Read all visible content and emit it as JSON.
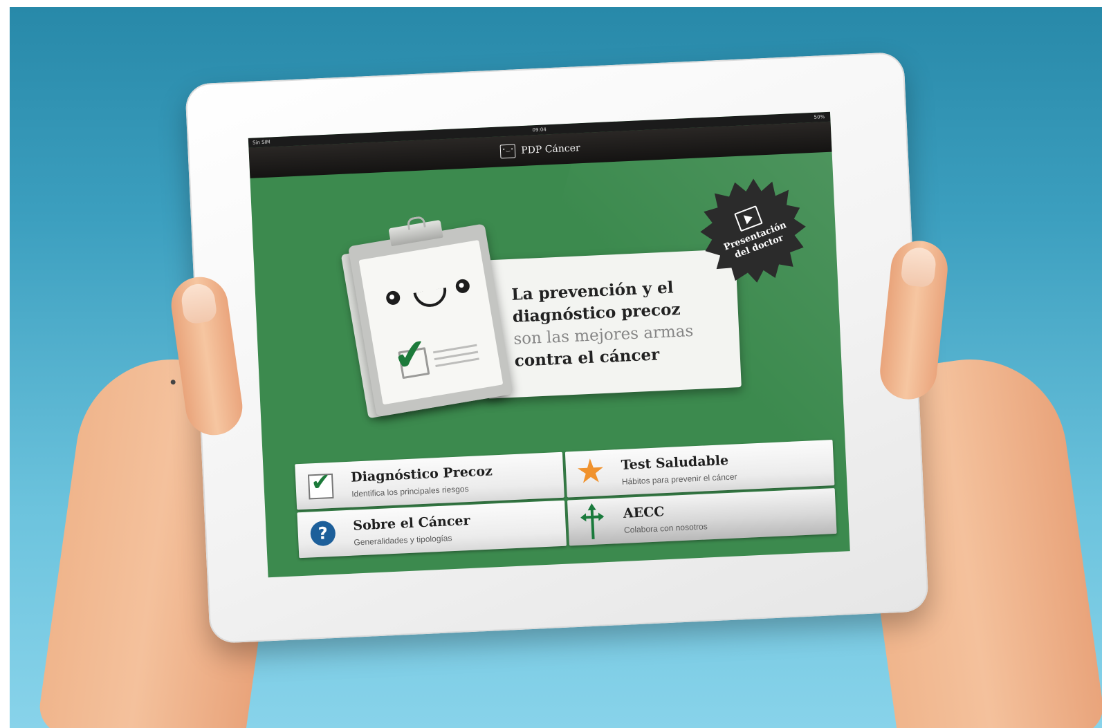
{
  "statusbar": {
    "carrier": "Sin SIM",
    "time": "09:04",
    "battery": "50%"
  },
  "navbar": {
    "title": "PDP Cáncer"
  },
  "hero": {
    "line1": "La prevención y el",
    "line2": "diagnóstico precoz",
    "line3": "son las mejores armas",
    "line4": "contra el cáncer"
  },
  "seal": {
    "line1": "Presentación",
    "line2": "del doctor"
  },
  "tiles": [
    {
      "title": "Diagnóstico Precoz",
      "subtitle": "Identifica los principales riesgos",
      "icon": "checkbox-icon"
    },
    {
      "title": "Test Saludable",
      "subtitle": "Hábitos para prevenir el cáncer",
      "icon": "star-icon"
    },
    {
      "title": "Sobre el Cáncer",
      "subtitle": "Generalidades y tipologías",
      "icon": "question-icon"
    },
    {
      "title": "AECC",
      "subtitle": "Colabora con nosotros",
      "icon": "aecc-cross-icon"
    }
  ],
  "colors": {
    "screen_green": "#3c8a4e",
    "accent_green": "#1c7a3a",
    "star_orange": "#f0922d",
    "question_blue": "#1d5f9a",
    "background_blue": "#3c9fbf"
  }
}
